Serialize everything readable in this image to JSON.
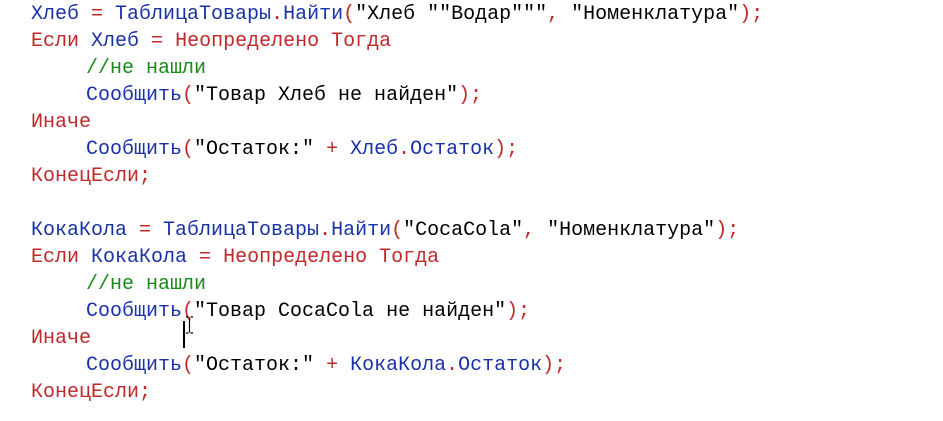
{
  "colors": {
    "keyword": "#c0282a",
    "identifier": "#1a32a8",
    "operator": "#c0282a",
    "string": "#000000",
    "comment": "#1a8a1a",
    "plain": "#000000"
  },
  "code_lines": [
    {
      "indent": 0,
      "tokens": [
        {
          "t": "Хлеб",
          "k": "identifier"
        },
        {
          "t": " = ",
          "k": "operator"
        },
        {
          "t": "ТаблицаТовары",
          "k": "identifier"
        },
        {
          "t": ".",
          "k": "operator"
        },
        {
          "t": "Найти",
          "k": "identifier"
        },
        {
          "t": "(",
          "k": "operator"
        },
        {
          "t": "\"Хлеб \"\"Водар\"\"\"",
          "k": "string"
        },
        {
          "t": ", ",
          "k": "operator"
        },
        {
          "t": "\"Номенклатура\"",
          "k": "string"
        },
        {
          "t": ");",
          "k": "operator"
        }
      ]
    },
    {
      "indent": 0,
      "tokens": [
        {
          "t": "Если",
          "k": "keyword"
        },
        {
          "t": " ",
          "k": "plain"
        },
        {
          "t": "Хлеб",
          "k": "identifier"
        },
        {
          "t": " = ",
          "k": "operator"
        },
        {
          "t": "Неопределено",
          "k": "keyword"
        },
        {
          "t": " ",
          "k": "plain"
        },
        {
          "t": "Тогда",
          "k": "keyword"
        }
      ]
    },
    {
      "indent": 1,
      "tokens": [
        {
          "t": "//не нашли",
          "k": "comment"
        }
      ]
    },
    {
      "indent": 1,
      "tokens": [
        {
          "t": "Сообщить",
          "k": "identifier"
        },
        {
          "t": "(",
          "k": "operator"
        },
        {
          "t": "\"Товар Хлеб не найден\"",
          "k": "string"
        },
        {
          "t": ");",
          "k": "operator"
        }
      ]
    },
    {
      "indent": 0,
      "tokens": [
        {
          "t": "Иначе",
          "k": "keyword"
        }
      ]
    },
    {
      "indent": 1,
      "tokens": [
        {
          "t": "Сообщить",
          "k": "identifier"
        },
        {
          "t": "(",
          "k": "operator"
        },
        {
          "t": "\"Остаток:\"",
          "k": "string"
        },
        {
          "t": " + ",
          "k": "operator"
        },
        {
          "t": "Хлеб",
          "k": "identifier"
        },
        {
          "t": ".",
          "k": "operator"
        },
        {
          "t": "Остаток",
          "k": "identifier"
        },
        {
          "t": ");",
          "k": "operator"
        }
      ]
    },
    {
      "indent": 0,
      "tokens": [
        {
          "t": "КонецЕсли",
          "k": "keyword"
        },
        {
          "t": ";",
          "k": "operator"
        }
      ]
    },
    {
      "indent": 0,
      "tokens": []
    },
    {
      "indent": 0,
      "tokens": [
        {
          "t": "КокаКола",
          "k": "identifier"
        },
        {
          "t": " = ",
          "k": "operator"
        },
        {
          "t": "ТаблицаТовары",
          "k": "identifier"
        },
        {
          "t": ".",
          "k": "operator"
        },
        {
          "t": "Найти",
          "k": "identifier"
        },
        {
          "t": "(",
          "k": "operator"
        },
        {
          "t": "\"CocaCola\"",
          "k": "string"
        },
        {
          "t": ", ",
          "k": "operator"
        },
        {
          "t": "\"Номенклатура\"",
          "k": "string"
        },
        {
          "t": ");",
          "k": "operator"
        }
      ]
    },
    {
      "indent": 0,
      "tokens": [
        {
          "t": "Если",
          "k": "keyword"
        },
        {
          "t": " ",
          "k": "plain"
        },
        {
          "t": "КокаКола",
          "k": "identifier"
        },
        {
          "t": " = ",
          "k": "operator"
        },
        {
          "t": "Неопределено",
          "k": "keyword"
        },
        {
          "t": " ",
          "k": "plain"
        },
        {
          "t": "Тогда",
          "k": "keyword"
        }
      ]
    },
    {
      "indent": 1,
      "tokens": [
        {
          "t": "//не нашли",
          "k": "comment"
        }
      ]
    },
    {
      "indent": 1,
      "tokens": [
        {
          "t": "Сообщить",
          "k": "identifier"
        },
        {
          "t": "(",
          "k": "operator"
        },
        {
          "t": "\"Товар CocaCola не найден\"",
          "k": "string"
        },
        {
          "t": ");",
          "k": "operator"
        }
      ]
    },
    {
      "indent": 0,
      "tokens": [
        {
          "t": "Иначе",
          "k": "keyword"
        }
      ]
    },
    {
      "indent": 1,
      "tokens": [
        {
          "t": "Сообщить",
          "k": "identifier"
        },
        {
          "t": "(",
          "k": "operator"
        },
        {
          "t": "\"Остаток:\"",
          "k": "string"
        },
        {
          "t": " + ",
          "k": "operator"
        },
        {
          "t": "КокаКола",
          "k": "identifier"
        },
        {
          "t": ".",
          "k": "operator"
        },
        {
          "t": "Остаток",
          "k": "identifier"
        },
        {
          "t": ");",
          "k": "operator"
        }
      ]
    },
    {
      "indent": 0,
      "tokens": [
        {
          "t": "КонецЕсли",
          "k": "keyword"
        },
        {
          "t": ";",
          "k": "operator"
        }
      ]
    }
  ]
}
